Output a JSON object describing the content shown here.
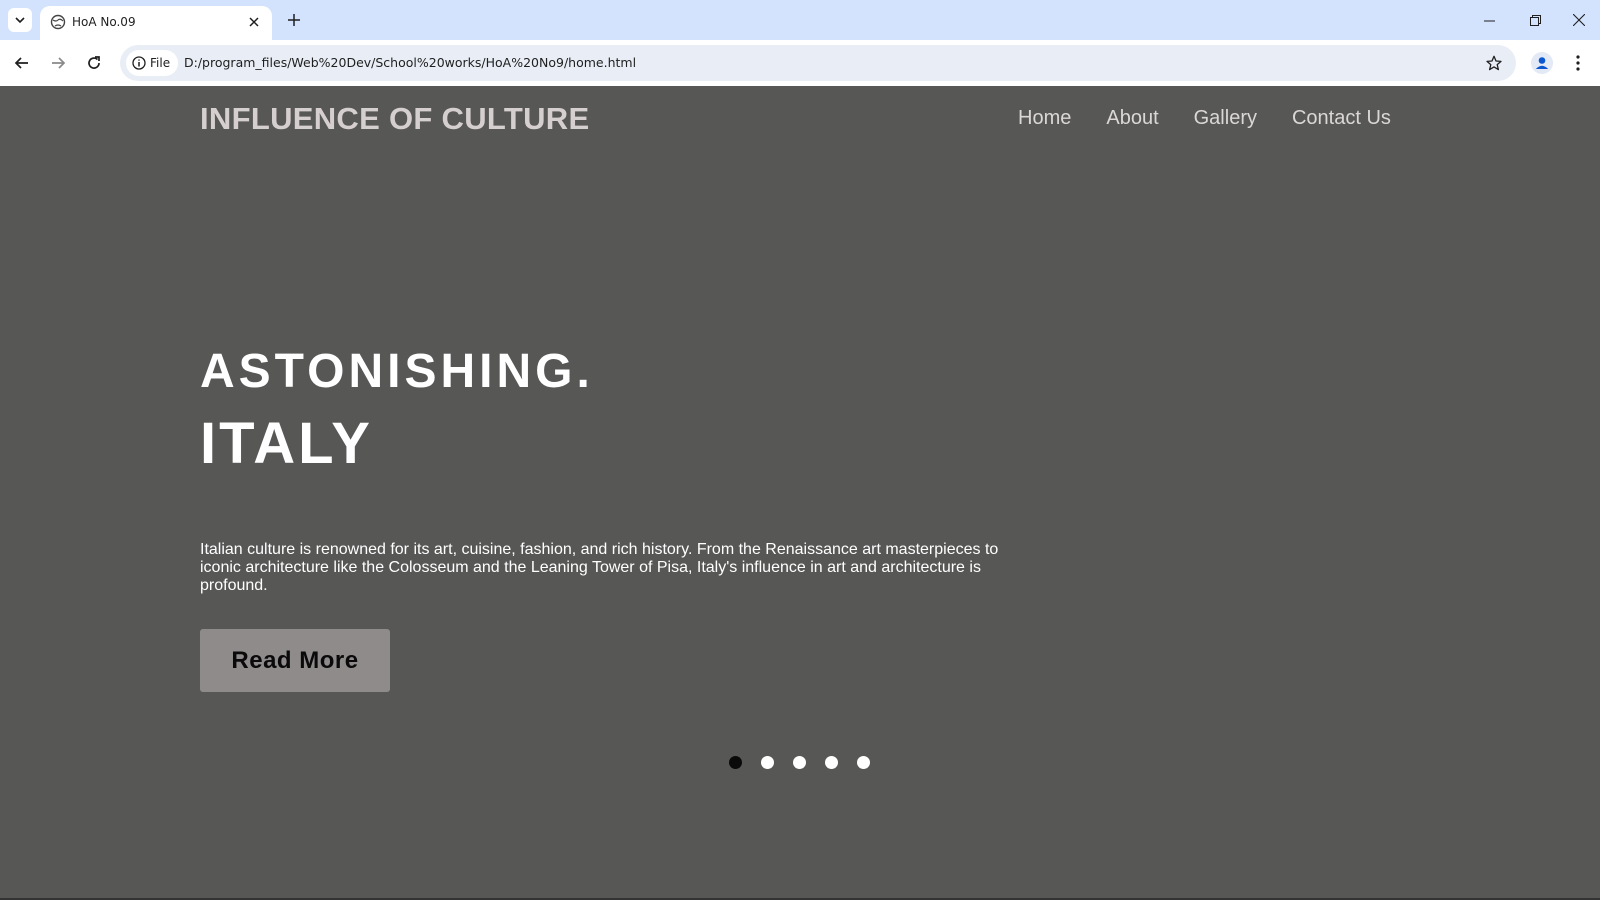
{
  "browser": {
    "tab": {
      "title": "HoA No.09"
    },
    "site_chip_label": "File",
    "url": "D:/program_files/Web%20Dev/School%20works/HoA%20No9/home.html"
  },
  "site": {
    "logo": "INFLUENCE OF CULTURE",
    "nav": {
      "home": "Home",
      "about": "About",
      "gallery": "Gallery",
      "contact": "Contact Us"
    }
  },
  "hero": {
    "line1": "ASTONISHING.",
    "line2": "ITALY",
    "description": "Italian culture is renowned for its art, cuisine, fashion, and rich history. From the Renaissance art masterpieces to iconic architecture like the Colosseum and the Leaning Tower of Pisa, Italy's influence in art and architecture is profound.",
    "button_label": "Read More"
  },
  "slider": {
    "total": 5,
    "active": 1
  },
  "colors": {
    "page_background": "#575756",
    "button_background": "#8f8b8b",
    "chrome_tabstrip": "#d3e3fd",
    "active_dot": "#0a0a0a"
  }
}
